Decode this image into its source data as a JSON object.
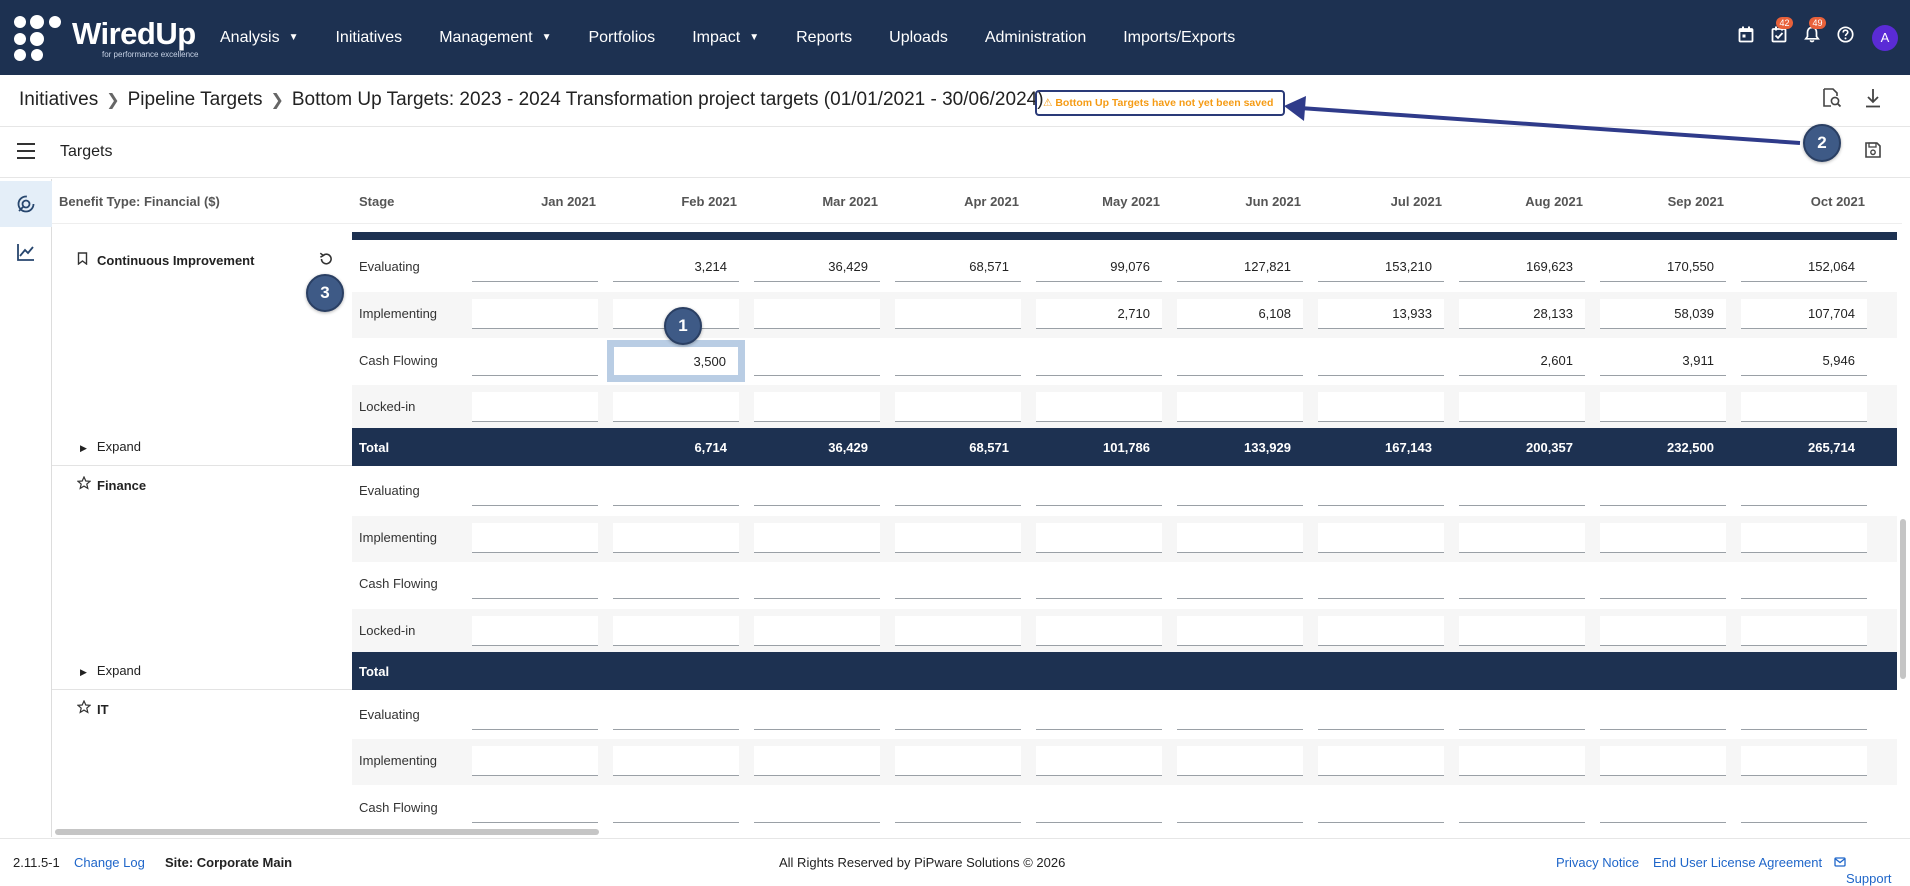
{
  "nav": {
    "logo_name": "WiredUp",
    "logo_tagline": "for performance excellence",
    "menu": [
      {
        "label": "Analysis",
        "has_caret": true
      },
      {
        "label": "Initiatives",
        "has_caret": false
      },
      {
        "label": "Management",
        "has_caret": true
      },
      {
        "label": "Portfolios",
        "has_caret": false
      },
      {
        "label": "Impact",
        "has_caret": true
      },
      {
        "label": "Reports",
        "has_caret": false
      },
      {
        "label": "Uploads",
        "has_caret": false
      },
      {
        "label": "Administration",
        "has_caret": false
      },
      {
        "label": "Imports/Exports",
        "has_caret": false
      }
    ],
    "icons": {
      "calendar": "calendar-icon",
      "tasks": "tasks-icon",
      "tasks_badge": "42",
      "bell": "bell-icon",
      "bell_badge": "49",
      "help": "help-icon"
    },
    "avatar_initial": "A"
  },
  "breadcrumb": {
    "items": [
      "Initiatives",
      "Pipeline Targets",
      "Bottom Up Targets: 2023 - 2024 Transformation project targets (01/01/2021 - 30/06/2024)"
    ],
    "warning": "Bottom Up Targets have not yet been saved"
  },
  "toolbar": {
    "title": "Targets"
  },
  "grid": {
    "benefit_type": "Benefit Type: Financial ($)",
    "stage_header": "Stage",
    "months": [
      "Jan 2021",
      "Feb 2021",
      "Mar 2021",
      "Apr 2021",
      "May 2021",
      "Jun 2021",
      "Jul 2021",
      "Aug 2021",
      "Sep 2021",
      "Oct 2021"
    ],
    "groups": [
      {
        "name": "Continuous Improvement",
        "icon": "bookmark-icon",
        "rows": [
          {
            "stage": "Evaluating",
            "values": [
              "",
              "3,214",
              "36,429",
              "68,571",
              "99,076",
              "127,821",
              "153,210",
              "169,623",
              "170,550",
              "152,064"
            ]
          },
          {
            "stage": "Implementing",
            "values": [
              "",
              "",
              "",
              "",
              "2,710",
              "6,108",
              "13,933",
              "28,133",
              "58,039",
              "107,704"
            ]
          },
          {
            "stage": "Cash Flowing",
            "values": [
              "",
              "3,500",
              "",
              "",
              "",
              "",
              "",
              "2,601",
              "3,911",
              "5,946"
            ]
          },
          {
            "stage": "Locked-in",
            "values": [
              "",
              "",
              "",
              "",
              "",
              "",
              "",
              "",
              "",
              ""
            ]
          }
        ],
        "expand_label": "Expand",
        "total_label": "Total",
        "totals": [
          "",
          "6,714",
          "36,429",
          "68,571",
          "101,786",
          "133,929",
          "167,143",
          "200,357",
          "232,500",
          "265,714"
        ]
      },
      {
        "name": "Finance",
        "icon": "star-icon",
        "rows": [
          {
            "stage": "Evaluating",
            "values": [
              "",
              "",
              "",
              "",
              "",
              "",
              "",
              "",
              "",
              ""
            ]
          },
          {
            "stage": "Implementing",
            "values": [
              "",
              "",
              "",
              "",
              "",
              "",
              "",
              "",
              "",
              ""
            ]
          },
          {
            "stage": "Cash Flowing",
            "values": [
              "",
              "",
              "",
              "",
              "",
              "",
              "",
              "",
              "",
              ""
            ]
          },
          {
            "stage": "Locked-in",
            "values": [
              "",
              "",
              "",
              "",
              "",
              "",
              "",
              "",
              "",
              ""
            ]
          }
        ],
        "expand_label": "Expand",
        "total_label": "Total",
        "totals": [
          "",
          "",
          "",
          "",
          "",
          "",
          "",
          "",
          "",
          ""
        ]
      },
      {
        "name": "IT",
        "icon": "star-icon",
        "rows": [
          {
            "stage": "Evaluating",
            "values": [
              "",
              "",
              "",
              "",
              "",
              "",
              "",
              "",
              "",
              ""
            ]
          },
          {
            "stage": "Implementing",
            "values": [
              "",
              "",
              "",
              "",
              "",
              "",
              "",
              "",
              "",
              ""
            ]
          },
          {
            "stage": "Cash Flowing",
            "values": [
              "",
              "",
              "",
              "",
              "",
              "",
              "",
              "",
              "",
              ""
            ]
          }
        ]
      }
    ]
  },
  "annotations": [
    "1",
    "2",
    "3"
  ],
  "footer": {
    "version": "2.11.5-1",
    "changelog": "Change Log",
    "site": "Site: Corporate Main",
    "copyright": "All Rights Reserved by PiPware Solutions © 2026",
    "privacy": "Privacy Notice",
    "eula": "End User License Agreement",
    "support": "Support"
  },
  "colors": {
    "nav_bg": "#1d3151",
    "accent_link": "#1f66c9",
    "warning_text": "#f59b14",
    "marker": "#3e5a86"
  }
}
